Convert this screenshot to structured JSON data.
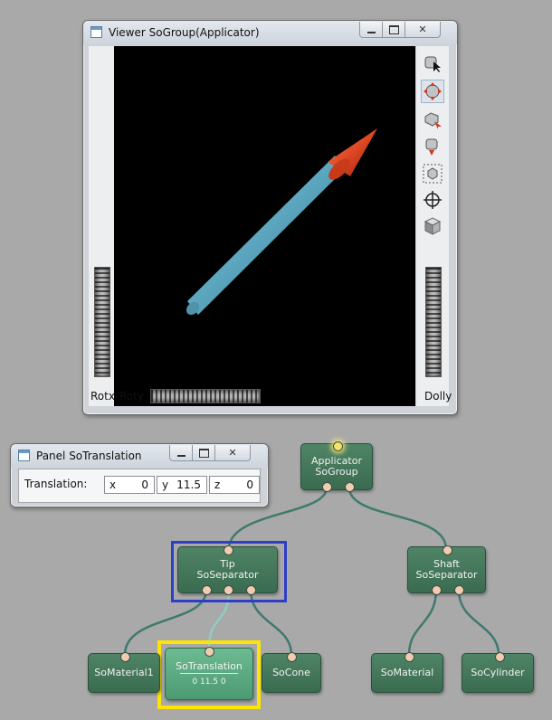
{
  "viewer": {
    "title": "Viewer SoGroup(Applicator)",
    "rotx_label": "Rotx",
    "roty_label": "Roty",
    "dolly_label": "Dolly",
    "tools": [
      "pick-arrow-icon",
      "rotate-view-icon",
      "seek-icon",
      "zoom-home-icon",
      "view-all-icon",
      "center-target-icon",
      "shaded-cube-icon"
    ]
  },
  "panel": {
    "title": "Panel SoTranslation",
    "translation_label": "Translation:",
    "x_label": "x",
    "x_value": "0",
    "y_label": "y",
    "y_value": "11.5",
    "z_label": "z",
    "z_value": "0"
  },
  "graph": {
    "applicator": {
      "name": "Applicator",
      "type": "SoGroup"
    },
    "tip": {
      "name": "Tip",
      "type": "SoSeparator"
    },
    "shaft": {
      "name": "Shaft",
      "type": "SoSeparator"
    },
    "somaterial1": {
      "label": "SoMaterial1"
    },
    "sotranslation": {
      "label": "SoTranslation",
      "value": "0 11.5 0"
    },
    "socone": {
      "label": "SoCone"
    },
    "somaterial": {
      "label": "SoMaterial"
    },
    "socylinder": {
      "label": "SoCylinder"
    }
  },
  "colors": {
    "node": "#3f7257",
    "node_selected": "#5cab83",
    "tip_highlight": "#2c3fc6",
    "translation_highlight": "#ffe400",
    "wire": "#3f7a6d",
    "port": "#f2ccb0",
    "shaft": "#5aa4bd",
    "cone": "#d84320"
  }
}
